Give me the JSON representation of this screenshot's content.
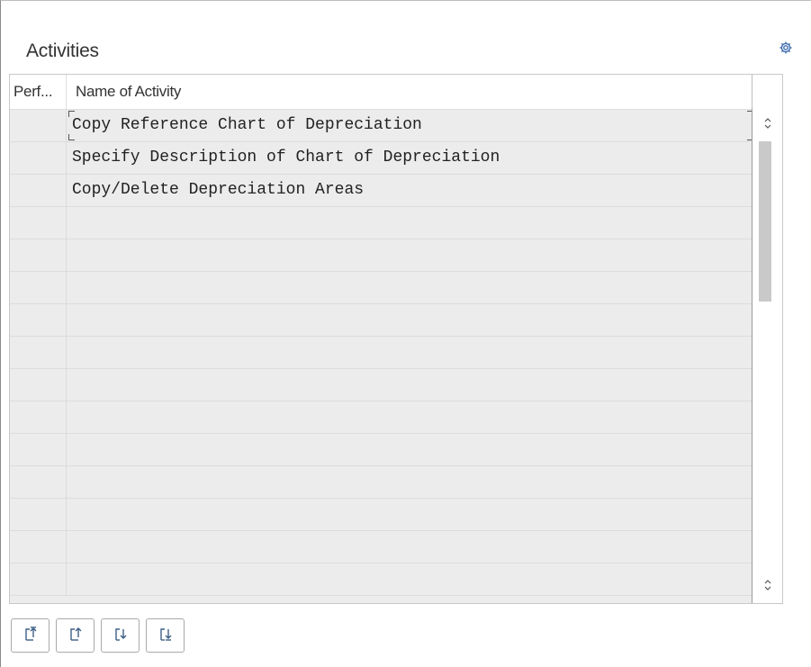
{
  "panel": {
    "title": "Activities"
  },
  "table": {
    "columns": [
      "Perf...",
      "Name of Activity"
    ],
    "rows": [
      {
        "performed": "",
        "name": "Copy Reference Chart of Depreciation",
        "focused": true
      },
      {
        "performed": "",
        "name": "Specify Description of Chart of Depreciation",
        "focused": false
      },
      {
        "performed": "",
        "name": "Copy/Delete Depreciation Areas",
        "focused": false
      },
      {
        "performed": "",
        "name": "",
        "focused": false
      },
      {
        "performed": "",
        "name": "",
        "focused": false
      },
      {
        "performed": "",
        "name": "",
        "focused": false
      },
      {
        "performed": "",
        "name": "",
        "focused": false
      },
      {
        "performed": "",
        "name": "",
        "focused": false
      },
      {
        "performed": "",
        "name": "",
        "focused": false
      },
      {
        "performed": "",
        "name": "",
        "focused": false
      },
      {
        "performed": "",
        "name": "",
        "focused": false
      },
      {
        "performed": "",
        "name": "",
        "focused": false
      },
      {
        "performed": "",
        "name": "",
        "focused": false
      },
      {
        "performed": "",
        "name": "",
        "focused": false
      },
      {
        "performed": "",
        "name": "",
        "focused": false
      }
    ]
  },
  "icons": {
    "settings": "gear-icon",
    "scroll_up": "chevron-up-icon",
    "scroll_down": "chevron-down-icon",
    "toolbar": [
      "move-to-top-icon",
      "move-up-icon",
      "move-down-icon",
      "move-to-bottom-icon"
    ]
  },
  "colors": {
    "row_background": "#ececec",
    "header_background": "#ffffff",
    "scroll_thumb": "#c9c9c9"
  }
}
